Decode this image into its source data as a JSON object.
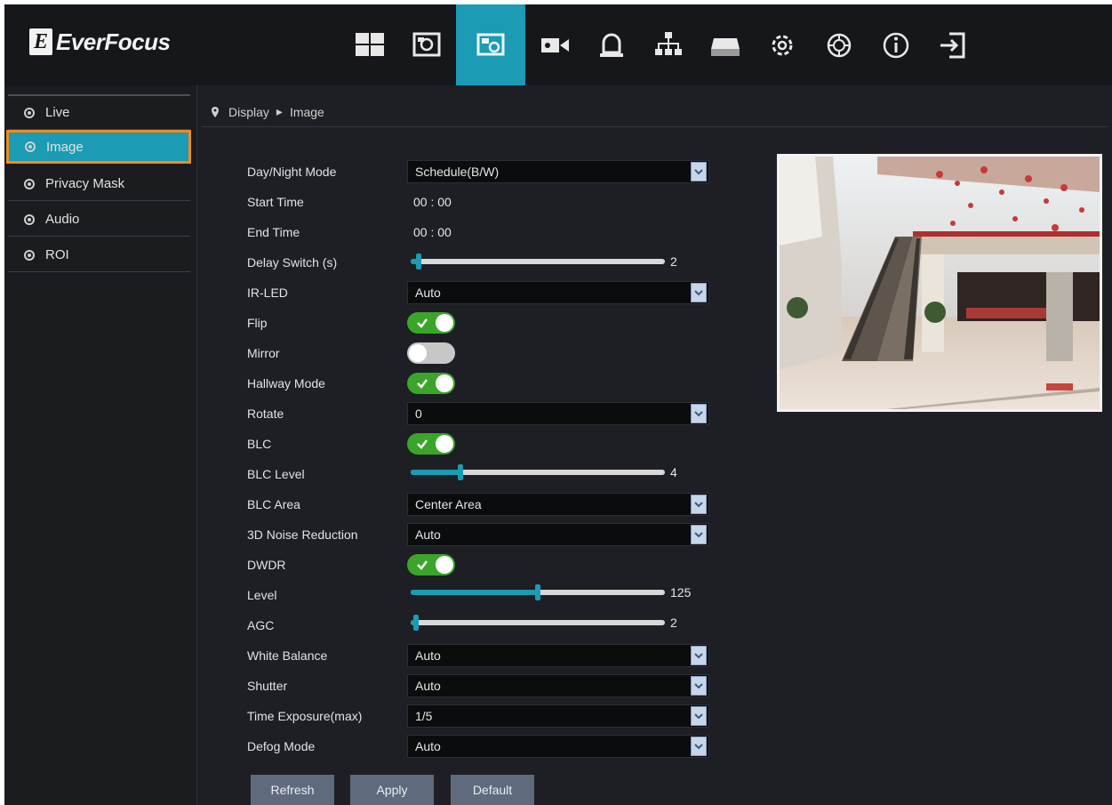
{
  "brand": {
    "mark": "E",
    "name": "EverFocus"
  },
  "nav": [
    {
      "icon": "multi-view-icon"
    },
    {
      "icon": "display-icon"
    },
    {
      "icon": "image-settings-icon",
      "active": true
    },
    {
      "icon": "camera-icon"
    },
    {
      "icon": "alarm-bell-icon"
    },
    {
      "icon": "network-icon"
    },
    {
      "icon": "storage-icon"
    },
    {
      "icon": "gear-icon"
    },
    {
      "icon": "system-wheel-icon"
    },
    {
      "icon": "info-icon"
    },
    {
      "icon": "logout-icon"
    }
  ],
  "sidebar": {
    "items": [
      {
        "label": "Live"
      },
      {
        "label": "Image",
        "active": true
      },
      {
        "label": "Privacy Mask"
      },
      {
        "label": "Audio"
      },
      {
        "label": "ROI"
      }
    ]
  },
  "breadcrumb": {
    "root": "Display",
    "separator": "▸",
    "current": "Image"
  },
  "settings": {
    "day_night_mode": {
      "label": "Day/Night Mode",
      "value": "Schedule(B/W)"
    },
    "start_time": {
      "label": "Start Time",
      "value": "00 : 00"
    },
    "end_time": {
      "label": "End Time",
      "value": "00 : 00"
    },
    "delay_switch": {
      "label": "Delay Switch (s)",
      "value": "2",
      "fraction": 0.02
    },
    "ir_led": {
      "label": "IR-LED",
      "value": "Auto"
    },
    "flip": {
      "label": "Flip",
      "on": true
    },
    "mirror": {
      "label": "Mirror",
      "on": false
    },
    "hallway_mode": {
      "label": "Hallway Mode",
      "on": true
    },
    "rotate": {
      "label": "Rotate",
      "value": "0"
    },
    "blc": {
      "label": "BLC",
      "on": true
    },
    "blc_level": {
      "label": "BLC Level",
      "value": "4",
      "fraction": 0.19
    },
    "blc_area": {
      "label": "BLC Area",
      "value": "Center Area"
    },
    "noise_reduction": {
      "label": "3D Noise Reduction",
      "value": "Auto"
    },
    "dwdr": {
      "label": "DWDR",
      "on": true
    },
    "level": {
      "label": "Level",
      "value": "125",
      "fraction": 0.5
    },
    "agc": {
      "label": "AGC",
      "value": "2",
      "fraction": 0.01
    },
    "white_balance": {
      "label": "White Balance",
      "value": "Auto"
    },
    "shutter": {
      "label": "Shutter",
      "value": "Auto"
    },
    "time_exposure": {
      "label": "Time Exposure(max)",
      "value": "1/5"
    },
    "defog_mode": {
      "label": "Defog Mode",
      "value": "Auto"
    }
  },
  "buttons": {
    "refresh": "Refresh",
    "apply": "Apply",
    "default": "Default"
  },
  "colors": {
    "accent": "#1b9bb4",
    "toggle_on": "#3aa52a",
    "highlight": "#f08c1e"
  }
}
